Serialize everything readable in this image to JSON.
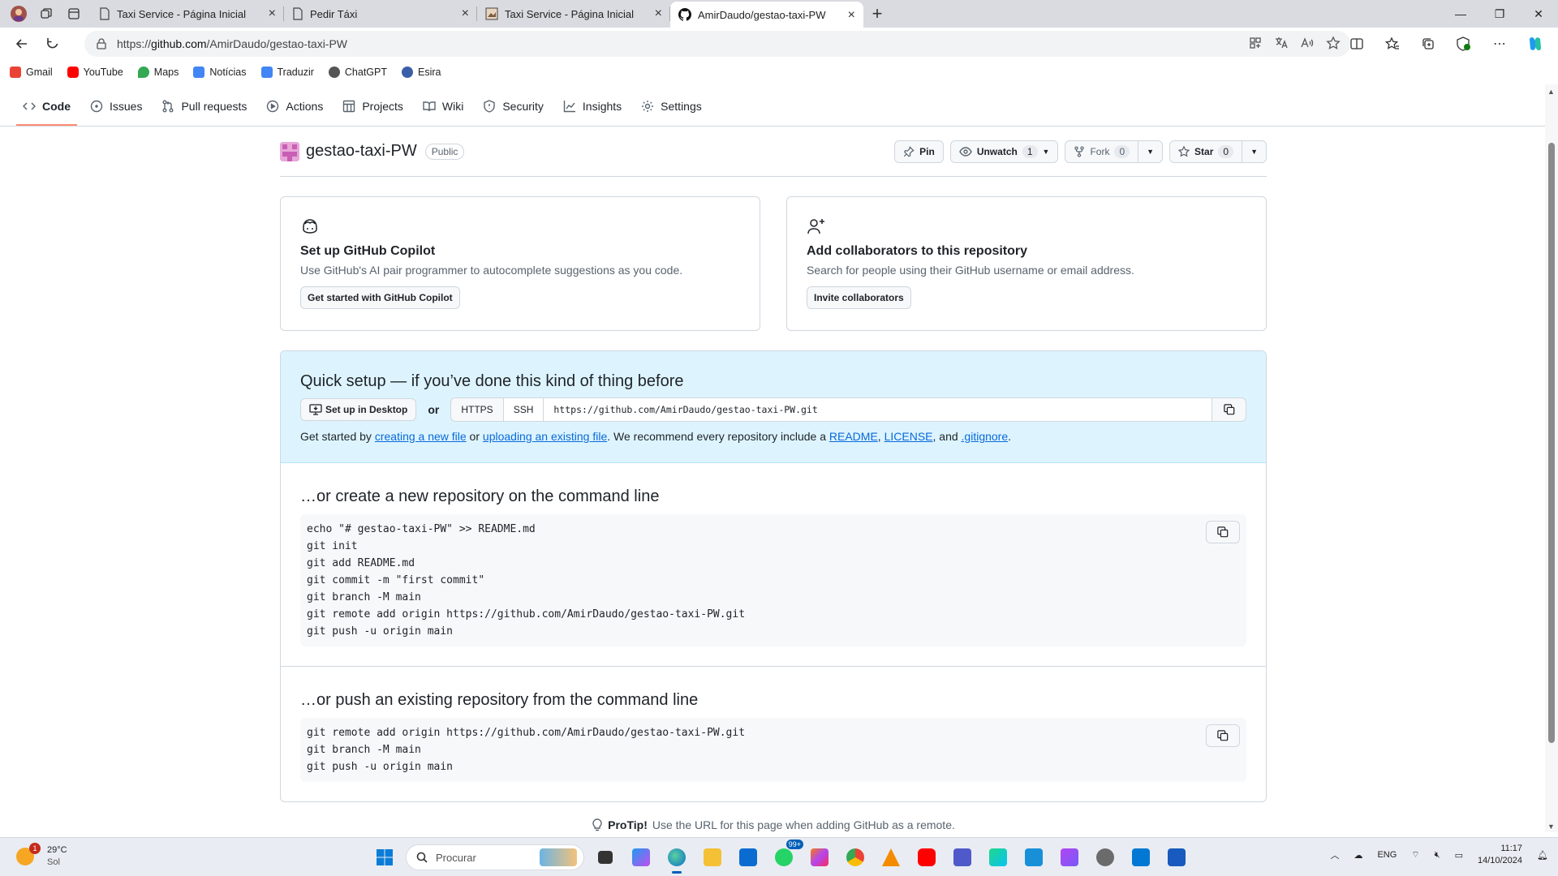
{
  "browser": {
    "tabs": [
      {
        "title": "Taxi Service - Página Inicial",
        "active": false
      },
      {
        "title": "Pedir Táxi",
        "active": false
      },
      {
        "title": "Taxi Service - Página Inicial",
        "active": false
      },
      {
        "title": "AmirDaudo/gestao-taxi-PW",
        "active": true
      }
    ],
    "url_prefix": "https://",
    "url_host": "github.com",
    "url_path": "/AmirDaudo/gestao-taxi-PW",
    "bookmarks": [
      {
        "label": "Gmail",
        "icon": "gmail-icon",
        "color": "#ea4335"
      },
      {
        "label": "YouTube",
        "icon": "youtube-icon",
        "color": "#ff0000"
      },
      {
        "label": "Maps",
        "icon": "maps-icon",
        "color": "#34a853"
      },
      {
        "label": "Notícias",
        "icon": "news-icon",
        "color": "#4285f4"
      },
      {
        "label": "Traduzir",
        "icon": "translate-icon",
        "color": "#4285f4"
      },
      {
        "label": "ChatGPT",
        "icon": "chatgpt-icon",
        "color": "#555555"
      },
      {
        "label": "Esira",
        "icon": "esira-icon",
        "color": "#3a5fa8"
      }
    ]
  },
  "repo_nav": [
    {
      "label": "Code",
      "icon": "code-icon",
      "active": true
    },
    {
      "label": "Issues",
      "icon": "issues-icon"
    },
    {
      "label": "Pull requests",
      "icon": "pull-request-icon"
    },
    {
      "label": "Actions",
      "icon": "actions-icon"
    },
    {
      "label": "Projects",
      "icon": "projects-icon"
    },
    {
      "label": "Wiki",
      "icon": "wiki-icon"
    },
    {
      "label": "Security",
      "icon": "shield-icon"
    },
    {
      "label": "Insights",
      "icon": "graph-icon"
    },
    {
      "label": "Settings",
      "icon": "gear-icon"
    }
  ],
  "repo": {
    "name": "gestao-taxi-PW",
    "visibility": "Public",
    "pin_label": "Pin",
    "unwatch_label": "Unwatch",
    "watch_count": "1",
    "fork_label": "Fork",
    "fork_count": "0",
    "star_label": "Star",
    "star_count": "0"
  },
  "cards": {
    "copilot": {
      "title": "Set up GitHub Copilot",
      "desc": "Use GitHub's AI pair programmer to autocomplete suggestions as you code.",
      "button": "Get started with GitHub Copilot"
    },
    "collab": {
      "title": "Add collaborators to this repository",
      "desc": "Search for people using their GitHub username or email address.",
      "button": "Invite collaborators"
    }
  },
  "quick_setup": {
    "title": "Quick setup — if you’ve done this kind of thing before",
    "desktop_button": "Set up in Desktop",
    "or": "or",
    "https": "HTTPS",
    "ssh": "SSH",
    "clone_url": "https://github.com/AmirDaudo/gestao-taxi-PW.git",
    "hint_start": "Get started by ",
    "link_new_file": "creating a new file",
    "hint_or": " or ",
    "link_upload": "uploading an existing file",
    "hint_mid": ". We recommend every repository include a ",
    "link_readme": "README",
    "comma1": ", ",
    "link_license": "LICENSE",
    "hint_and": ", and ",
    "link_gitignore": ".gitignore",
    "hint_end": "."
  },
  "new_repo": {
    "title": "…or create a new repository on the command line",
    "lines": [
      "echo \"# gestao-taxi-PW\" >> README.md",
      "git init",
      "git add README.md",
      "git commit -m \"first commit\"",
      "git branch -M main",
      "git remote add origin https://github.com/AmirDaudo/gestao-taxi-PW.git",
      "git push -u origin main"
    ]
  },
  "push_repo": {
    "title": "…or push an existing repository from the command line",
    "lines": [
      "git remote add origin https://github.com/AmirDaudo/gestao-taxi-PW.git",
      "git branch -M main",
      "git push -u origin main"
    ]
  },
  "protip": {
    "label": "ProTip!",
    "text": "Use the URL for this page when adding GitHub as a remote."
  },
  "taskbar": {
    "temp": "29°C",
    "condition": "Sol",
    "weather_badge": "1",
    "search_placeholder": "Procurar",
    "whatsapp_badge": "99+",
    "lang": "ENG",
    "time": "11:17",
    "date": "14/10/2024"
  }
}
